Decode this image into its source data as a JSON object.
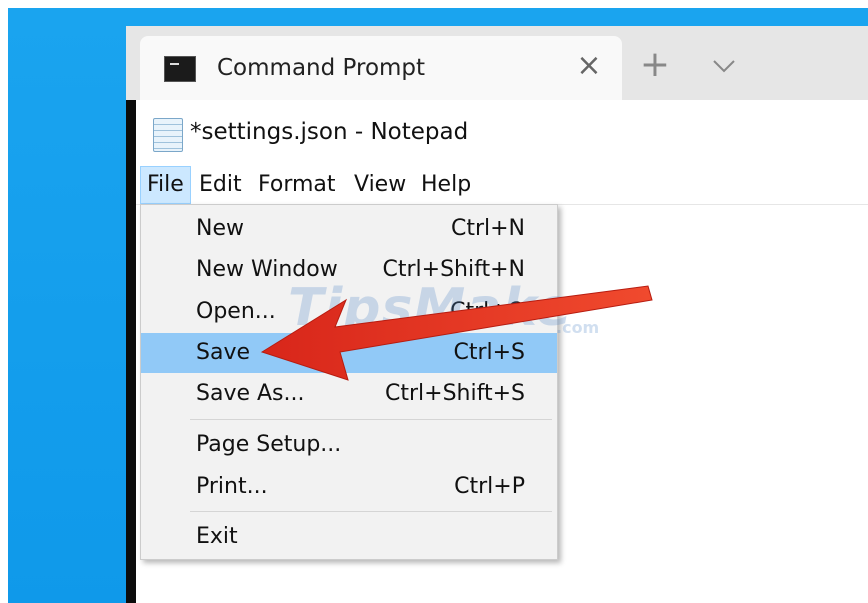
{
  "terminal": {
    "tab_title": "Command Prompt",
    "tab_icon": "cmd-icon",
    "close_icon": "close-icon",
    "new_tab_icon": "plus-icon",
    "dropdown_icon": "chevron-down-icon"
  },
  "notepad": {
    "title": "*settings.json - Notepad",
    "icon": "notepad-icon"
  },
  "menubar": {
    "items": [
      {
        "label": "File"
      },
      {
        "label": "Edit"
      },
      {
        "label": "Format"
      },
      {
        "label": "View"
      },
      {
        "label": "Help"
      }
    ]
  },
  "file_menu": {
    "items": [
      {
        "label": "New",
        "shortcut": "Ctrl+N"
      },
      {
        "label": "New Window",
        "shortcut": "Ctrl+Shift+N"
      },
      {
        "label": "Open...",
        "shortcut": "Ctrl+O"
      },
      {
        "label": "Save",
        "shortcut": "Ctrl+S"
      },
      {
        "label": "Save As...",
        "shortcut": "Ctrl+Shift+S"
      },
      {
        "label": "Page Setup...",
        "shortcut": ""
      },
      {
        "label": "Print...",
        "shortcut": "Ctrl+P"
      },
      {
        "label": "Exit",
        "shortcut": ""
      }
    ]
  },
  "watermark": {
    "text": "TipsMake",
    "domain": ".com"
  },
  "annotation": {
    "arrow_color": "#e8321c",
    "points_to": "Save"
  },
  "colors": {
    "desktop": "#0f99ea",
    "highlight": "#91c9f7",
    "menu_active": "#cce8ff"
  }
}
